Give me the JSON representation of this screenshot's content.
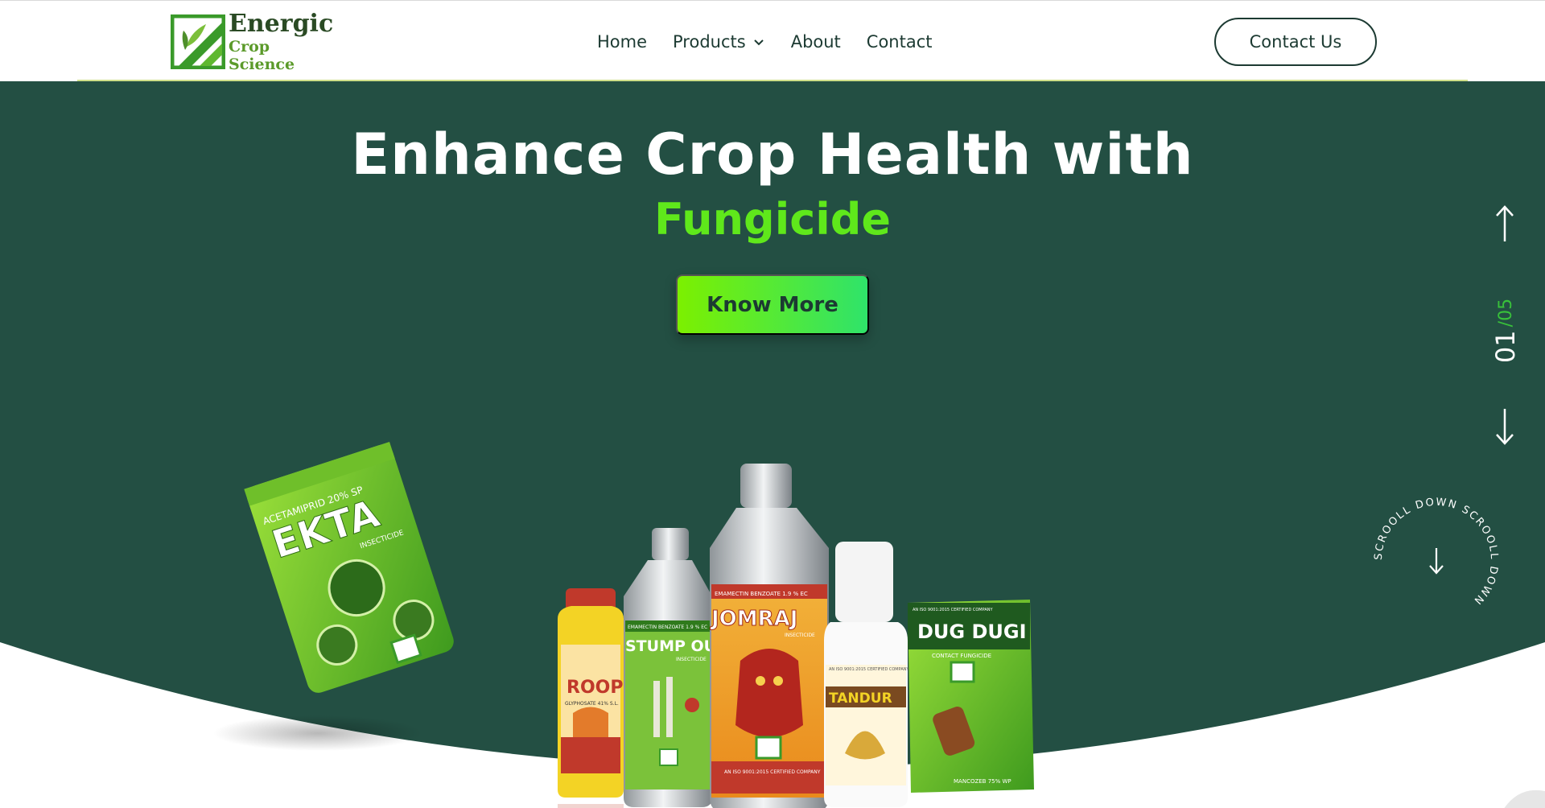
{
  "brand": {
    "title": "Energic",
    "subtitle": "Crop Science"
  },
  "nav": {
    "items": [
      {
        "label": "Home",
        "has_dropdown": false
      },
      {
        "label": "Products",
        "has_dropdown": true
      },
      {
        "label": "About",
        "has_dropdown": false
      },
      {
        "label": "Contact",
        "has_dropdown": false
      }
    ],
    "cta_label": "Contact Us"
  },
  "hero": {
    "title": "Enhance Crop Health with",
    "highlight": "Fungicide",
    "button_label": "Know More"
  },
  "pager": {
    "current": "01",
    "separator": "/",
    "total": "05"
  },
  "scroll_hint": {
    "text": "SCROOLL DOWN SCROOLL DOWN"
  },
  "products": [
    {
      "name": "EKTA",
      "tag": "ACETAMIPRID 20% SP",
      "type": "INSECTICIDE"
    },
    {
      "name": "ROOP",
      "tag": "GLYPHOSATE 41% S.L."
    },
    {
      "name": "STUMP OUT",
      "tag": "EMAMECTIN BENZOATE 1.9 % EC",
      "type": "INSECTICIDE"
    },
    {
      "name": "JOMRAJ",
      "tag": "EMAMECTIN BENZOATE 1.9 % EC",
      "type": "INSECTICIDE",
      "note": "AN ISO 9001:2015 CERTIFIED COMPANY"
    },
    {
      "name": "TANDUR",
      "tag": "AN ISO 9001:2015 CERTIFIED COMPANY"
    },
    {
      "name": "DUG DUGI",
      "tag": "AN ISO 9001:2015 CERTIFIED COMPANY",
      "type": "CONTACT FUNGICIDE",
      "note": "MANCOZEB 75% WP"
    }
  ],
  "colors": {
    "hero_bg": "#234f43",
    "accent_green": "#5fe81b",
    "button_gradient_start": "#7cf000",
    "button_gradient_end": "#2fe36a",
    "dark_text": "#1c3a32"
  },
  "icons": [
    "logo-mark-icon",
    "chevron-down-icon",
    "arrow-up-icon",
    "arrow-down-icon"
  ]
}
